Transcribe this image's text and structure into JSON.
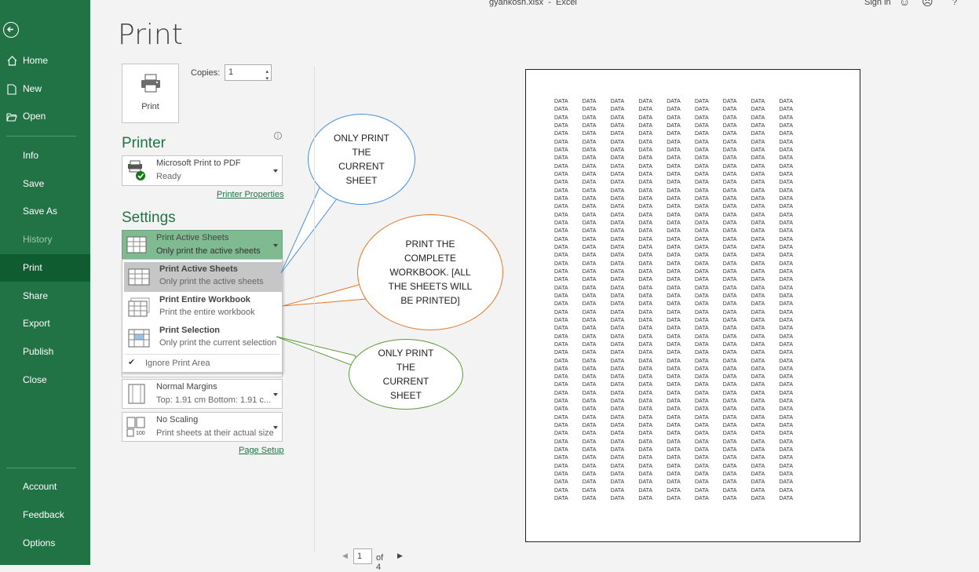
{
  "titlebar": {
    "title": "gyankosh.xlsx  -  Excel",
    "sign_in": "Sign in",
    "help": "?"
  },
  "sidebar": {
    "items": [
      {
        "label": "Home"
      },
      {
        "label": "New"
      },
      {
        "label": "Open"
      },
      {
        "label": "Info"
      },
      {
        "label": "Save"
      },
      {
        "label": "Save As"
      },
      {
        "label": "History"
      },
      {
        "label": "Print"
      },
      {
        "label": "Share"
      },
      {
        "label": "Export"
      },
      {
        "label": "Publish"
      },
      {
        "label": "Close"
      },
      {
        "label": "Account"
      },
      {
        "label": "Feedback"
      },
      {
        "label": "Options"
      }
    ],
    "active": "Print"
  },
  "main": {
    "title": "Print",
    "print_button_label": "Print",
    "copies_label": "Copies:",
    "copies_value": "1",
    "printer_heading": "Printer",
    "printer": {
      "name": "Microsoft Print to PDF",
      "status": "Ready"
    },
    "printer_properties_link": "Printer Properties",
    "settings_heading": "Settings",
    "what_to_print": {
      "title": "Print Active Sheets",
      "subtitle": "Only print the active sheets"
    },
    "menu": {
      "options": [
        {
          "title": "Print Active Sheets",
          "subtitle": "Only print the active sheets"
        },
        {
          "title": "Print Entire Workbook",
          "subtitle": "Print the entire workbook"
        },
        {
          "title": "Print Selection",
          "subtitle": "Only print the current selection"
        }
      ],
      "ignore_print_area": "Ignore Print Area"
    },
    "margins": {
      "title": "Normal Margins",
      "subtitle": "Top: 1.91 cm Bottom: 1.91 c..."
    },
    "scaling": {
      "title": "No Scaling",
      "subtitle": "Print sheets at their actual size",
      "icon_text": "100"
    },
    "page_setup_link": "Page Setup"
  },
  "callouts": {
    "active_sheets": "ONLY PRINT THE CURRENT SHEET",
    "entire_workbook": "PRINT THE COMPLETE WORKBOOK. [ALL THE SHEETS WILL BE PRINTED]",
    "selection": "ONLY PRINT THE CURRENT SHEET"
  },
  "preview": {
    "cell_text": "DATA",
    "columns": 9,
    "rows": 50
  },
  "pager": {
    "current": "1",
    "of_total": "of 4"
  },
  "colors": {
    "brand": "#217346",
    "active": "#0e5c2f",
    "accent_orange": "#e2772a",
    "accent_blue": "#4a90d9",
    "accent_green": "#5a9a3a"
  }
}
